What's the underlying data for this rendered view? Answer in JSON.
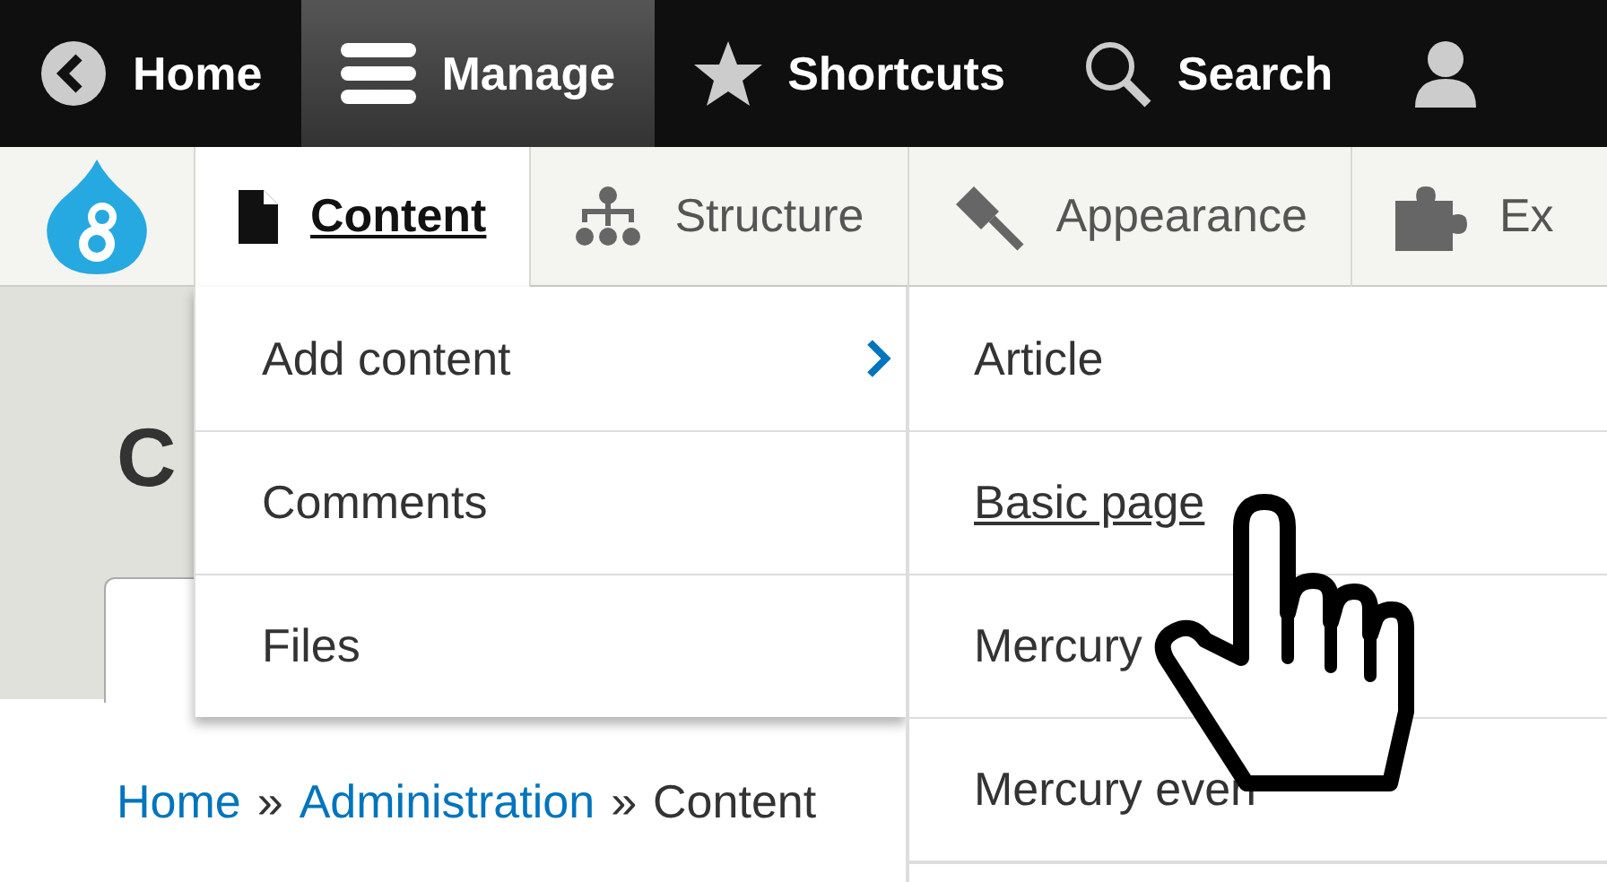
{
  "toolbar": {
    "items": [
      {
        "kind": "back",
        "label": "Home",
        "selected": false
      },
      {
        "kind": "menu",
        "label": "Manage",
        "selected": true
      },
      {
        "kind": "star",
        "label": "Shortcuts",
        "selected": false
      },
      {
        "kind": "search",
        "label": "Search",
        "selected": false
      },
      {
        "kind": "user",
        "selected": false
      }
    ]
  },
  "tray": {
    "tabs": [
      {
        "kind": "document",
        "label": "Content",
        "selected": true
      },
      {
        "kind": "hierarchy",
        "label": "Structure",
        "selected": false
      },
      {
        "kind": "brush",
        "label": "Appearance",
        "selected": false
      },
      {
        "kind": "puzzle",
        "label": "Ex",
        "selected": false
      }
    ]
  },
  "page": {
    "title": "C",
    "breadcrumb": [
      {
        "kind": "link",
        "label": "Home"
      },
      {
        "kind": "separator",
        "label": "»"
      },
      {
        "kind": "link",
        "label": "Administration"
      },
      {
        "kind": "separator",
        "label": "»"
      },
      {
        "kind": "text",
        "label": "Content"
      }
    ]
  },
  "menu": {
    "items": [
      {
        "label": "Add content",
        "submenu": true
      },
      {
        "label": "Comments",
        "submenu": false
      },
      {
        "label": "Files",
        "submenu": false
      }
    ]
  },
  "submenu": {
    "items": [
      {
        "label": "Article",
        "hovered": false
      },
      {
        "label": "Basic page",
        "hovered": true
      },
      {
        "label": "Mercury",
        "hovered": false
      },
      {
        "label": "Mercury even",
        "hovered": false
      }
    ]
  }
}
